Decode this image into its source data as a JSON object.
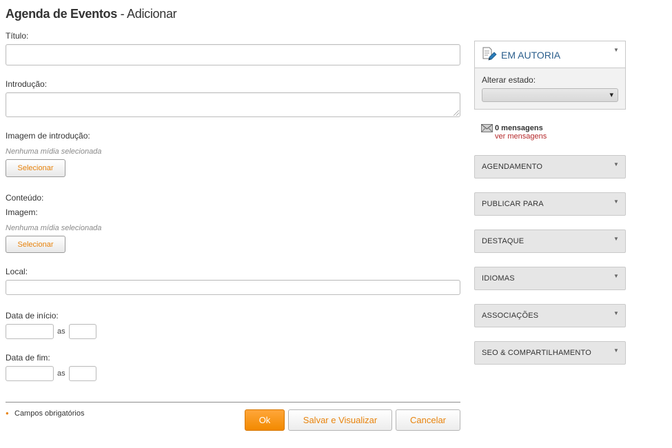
{
  "page": {
    "title_strong": "Agenda de Eventos",
    "title_rest": " - Adicionar"
  },
  "form": {
    "titulo_label": "Título:",
    "titulo_value": "",
    "introducao_label": "Introdução:",
    "introducao_value": "",
    "imagem_intro_label": "Imagem de introdução:",
    "imagem_intro_hint": "Nenhuma mídia selecionada",
    "imagem_intro_button": "Selecionar",
    "conteudo_label": "Conteúdo:",
    "imagem_label": "Imagem:",
    "imagem_hint": "Nenhuma mídia selecionada",
    "imagem_button": "Selecionar",
    "local_label": "Local:",
    "local_value": "",
    "inicio_label": "Data de início:",
    "inicio_date": "",
    "inicio_as": "as",
    "inicio_time": "",
    "fim_label": "Data de fim:",
    "fim_date": "",
    "fim_as": "as",
    "fim_time": ""
  },
  "footer": {
    "required_text": "Campos obrigatórios",
    "ok_label": "Ok",
    "save_view_label": "Salvar e Visualizar",
    "cancel_label": "Cancelar"
  },
  "sidebar": {
    "status_title": "EM AUTORIA",
    "change_state_label": "Alterar estado:",
    "state_value": "",
    "messages_count": "0 mensagens",
    "messages_link": "ver mensagens",
    "panels": [
      {
        "label": "AGENDAMENTO"
      },
      {
        "label": "PUBLICAR PARA"
      },
      {
        "label": "DESTAQUE"
      },
      {
        "label": "IDIOMAS"
      },
      {
        "label": "ASSOCIAÇÕES"
      },
      {
        "label": "SEO & COMPARTILHAMENTO"
      }
    ]
  },
  "colors": {
    "accent_orange": "#f28a00",
    "status_blue": "#2a5e8c",
    "link_red": "#b5282a"
  },
  "icons": {
    "status": "document-edit-icon",
    "messages": "envelope-icon",
    "collapse": "caret-down-icon"
  }
}
